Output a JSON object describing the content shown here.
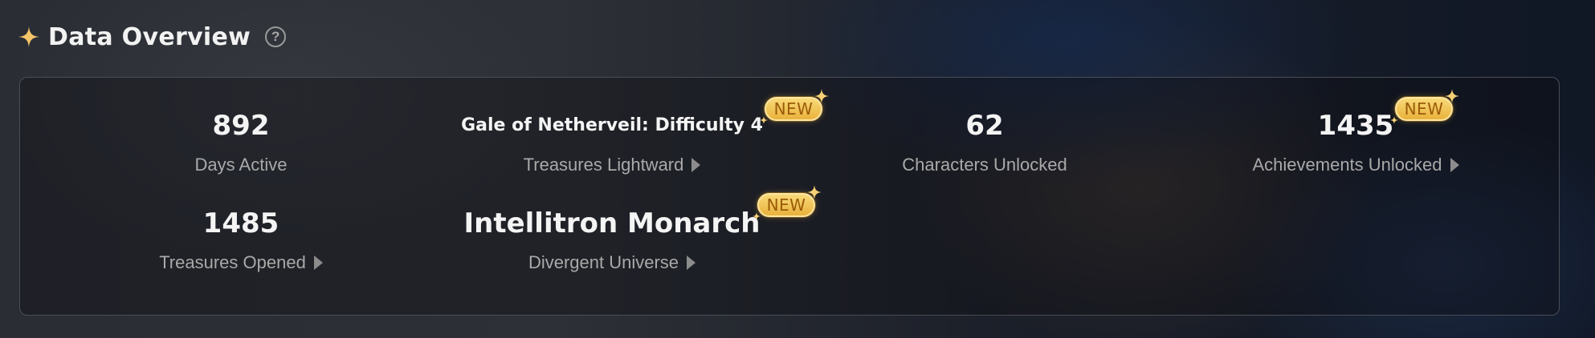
{
  "header": {
    "title": "Data Overview",
    "help_label": "?",
    "icon": "sparkle-icon",
    "accent": "#f3c468"
  },
  "stats": [
    {
      "value": "892",
      "label": "Days Active",
      "link": false,
      "new": false
    },
    {
      "value": "Gale of Netherveil: Difficulty 4",
      "label": "Treasures Lightward",
      "link": true,
      "new": true
    },
    {
      "value": "62",
      "label": "Characters Unlocked",
      "link": false,
      "new": false
    },
    {
      "value": "1435",
      "label": "Achievements Unlocked",
      "link": true,
      "new": true
    },
    {
      "value": "1485",
      "label": "Treasures Opened",
      "link": true,
      "new": false
    },
    {
      "value": "Intellitron Monarch",
      "label": "Divergent Universe",
      "link": true,
      "new": true
    }
  ],
  "badge": {
    "text": "NEW",
    "color": "#f1c458"
  }
}
